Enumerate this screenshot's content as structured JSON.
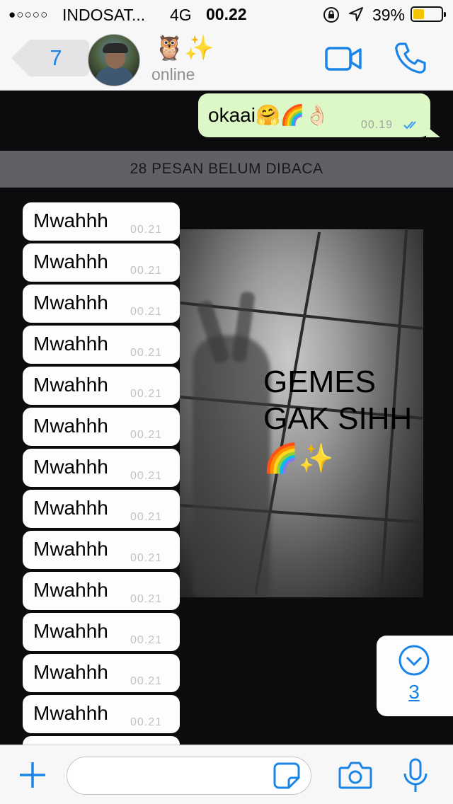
{
  "status_bar": {
    "signal": "●○○○○",
    "carrier": "INDOSAT...",
    "network": "4G",
    "time": "00.22",
    "battery_percent": "39%",
    "battery_level": 0.39,
    "battery_color": "#f5c400",
    "icons": [
      "orientation-lock-icon",
      "location-arrow-icon",
      "battery-icon"
    ]
  },
  "nav": {
    "back_count": "7",
    "contact_name": "🦉✨",
    "contact_status": "online",
    "accent_color": "#1a85e6",
    "icons": [
      "back-chevron-icon",
      "video-camera-icon",
      "phone-icon"
    ]
  },
  "chat": {
    "outgoing": {
      "text": "okaai🤗🌈👌🏻",
      "time": "00.19",
      "status_icon": "double-check-icon",
      "bubble_color": "#dcf8c6"
    },
    "unread_banner": "28 PESAN BELUM DIBACA",
    "image_caption_line1": "GEMES",
    "image_caption_line2": "GAK SIHH",
    "image_caption_emoji": "🌈✨",
    "incoming": [
      {
        "text": "Mwahhh",
        "time": "00.21"
      },
      {
        "text": "Mwahhh",
        "time": "00.21"
      },
      {
        "text": "Mwahhh",
        "time": "00.21"
      },
      {
        "text": "Mwahhh",
        "time": "00.21"
      },
      {
        "text": "Mwahhh",
        "time": "00.21"
      },
      {
        "text": "Mwahhh",
        "time": "00.21"
      },
      {
        "text": "Mwahhh",
        "time": "00.21"
      },
      {
        "text": "Mwahhh",
        "time": "00.21"
      },
      {
        "text": "Mwahhh",
        "time": "00.21"
      },
      {
        "text": "Mwahhh",
        "time": "00.21"
      },
      {
        "text": "Mwahhh",
        "time": "00.21"
      },
      {
        "text": "Mwahhh",
        "time": "00.21"
      },
      {
        "text": "Mwahhh",
        "time": "00.21"
      }
    ],
    "scroll_down_badge": "3"
  },
  "input_bar": {
    "message_value": "",
    "icons": [
      "plus-icon",
      "sticker-icon",
      "camera-icon",
      "microphone-icon"
    ]
  }
}
